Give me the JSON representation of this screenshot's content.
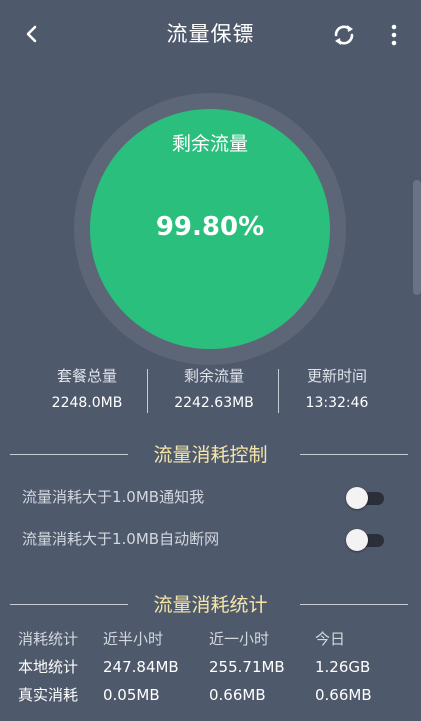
{
  "header": {
    "title": "流量保镖"
  },
  "gauge": {
    "label": "剩余流量",
    "value": "99.80%"
  },
  "stats": [
    {
      "label": "套餐总量",
      "value": "2248.0MB"
    },
    {
      "label": "剩余流量",
      "value": "2242.63MB"
    },
    {
      "label": "更新时间",
      "value": "13:32:46"
    }
  ],
  "control": {
    "title": "流量消耗控制",
    "items": [
      {
        "label": "流量消耗大于1.0MB通知我",
        "on": false
      },
      {
        "label": "流量消耗大于1.0MB自动断网",
        "on": false
      }
    ]
  },
  "statistics": {
    "title": "流量消耗统计",
    "columns": [
      "消耗统计",
      "近半小时",
      "近一小时",
      "今日"
    ],
    "rows": [
      [
        "本地统计",
        "247.84MB",
        "255.71MB",
        "1.26GB"
      ],
      [
        "真实消耗",
        "0.05MB",
        "0.66MB",
        "0.66MB"
      ]
    ]
  }
}
